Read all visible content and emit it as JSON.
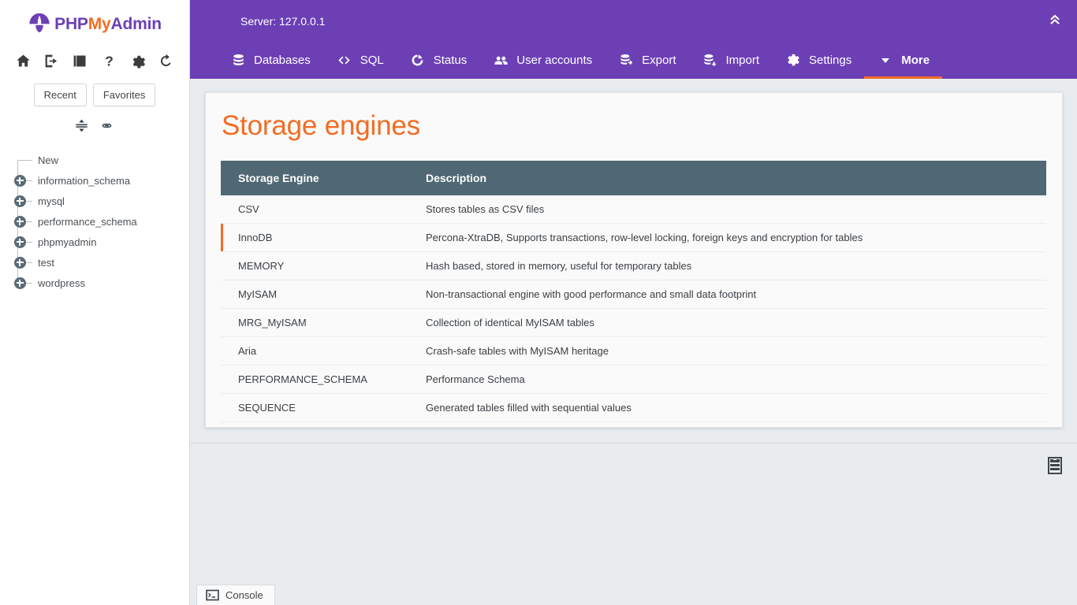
{
  "app": {
    "logo_php": "PHP",
    "logo_my": "My",
    "logo_admin": "Admin"
  },
  "sidebar": {
    "icons": [
      {
        "name": "home-icon",
        "label": "Home"
      },
      {
        "name": "logout-icon",
        "label": "Log out"
      },
      {
        "name": "documentation-icon",
        "label": "phpMyAdmin documentation"
      },
      {
        "name": "help-icon",
        "label": "Documentation"
      },
      {
        "name": "settings-icon",
        "label": "Navigation settings"
      },
      {
        "name": "reload-icon",
        "label": "Reload navigation panel"
      }
    ],
    "recent_label": "Recent",
    "favorites_label": "Favorites",
    "tools": [
      {
        "name": "collapse-all-icon",
        "label": "Collapse all"
      },
      {
        "name": "link-panels-icon",
        "label": "Link with main panel"
      }
    ],
    "tree": [
      {
        "label": "New",
        "expandable": false
      },
      {
        "label": "information_schema",
        "expandable": true
      },
      {
        "label": "mysql",
        "expandable": true
      },
      {
        "label": "performance_schema",
        "expandable": true
      },
      {
        "label": "phpmyadmin",
        "expandable": true
      },
      {
        "label": "test",
        "expandable": true
      },
      {
        "label": "wordpress",
        "expandable": true
      }
    ]
  },
  "header": {
    "server_line": "Server: 127.0.0.1",
    "collapse_icon": "double-chevron-up-icon",
    "tabs": [
      {
        "label": "Databases",
        "icon": "database-icon",
        "active": false
      },
      {
        "label": "SQL",
        "icon": "code-brackets-icon",
        "active": false
      },
      {
        "label": "Status",
        "icon": "status-circle-icon",
        "active": false
      },
      {
        "label": "User accounts",
        "icon": "users-icon",
        "active": false
      },
      {
        "label": "Export",
        "icon": "export-icon",
        "active": false
      },
      {
        "label": "Import",
        "icon": "import-icon",
        "active": false
      },
      {
        "label": "Settings",
        "icon": "gear-icon",
        "active": false
      },
      {
        "label": "More",
        "icon": "caret-down-icon",
        "active": true
      }
    ]
  },
  "main": {
    "page_title": "Storage engines",
    "table": {
      "columns": [
        "Storage Engine",
        "Description"
      ],
      "rows": [
        {
          "engine": "CSV",
          "description": "Stores tables as CSV files",
          "is_default": false
        },
        {
          "engine": "InnoDB",
          "description": "Percona-XtraDB, Supports transactions, row-level locking, foreign keys and encryption for tables",
          "is_default": true
        },
        {
          "engine": "MEMORY",
          "description": "Hash based, stored in memory, useful for temporary tables",
          "is_default": false
        },
        {
          "engine": "MyISAM",
          "description": "Non-transactional engine with good performance and small data footprint",
          "is_default": false
        },
        {
          "engine": "MRG_MyISAM",
          "description": "Collection of identical MyISAM tables",
          "is_default": false
        },
        {
          "engine": "Aria",
          "description": "Crash-safe tables with MyISAM heritage",
          "is_default": false
        },
        {
          "engine": "PERFORMANCE_SCHEMA",
          "description": "Performance Schema",
          "is_default": false
        },
        {
          "engine": "SEQUENCE",
          "description": "Generated tables filled with sequential values",
          "is_default": false
        }
      ]
    }
  },
  "footer": {
    "server_icon": "server-icon",
    "console_label": "Console",
    "console_icon": "terminal-icon"
  },
  "colors": {
    "brand_purple": "#6c3fb5",
    "accent_orange": "#f26c23",
    "table_header": "#4f6874",
    "page_background": "#e8ecef",
    "card_background": "#fafafa"
  }
}
